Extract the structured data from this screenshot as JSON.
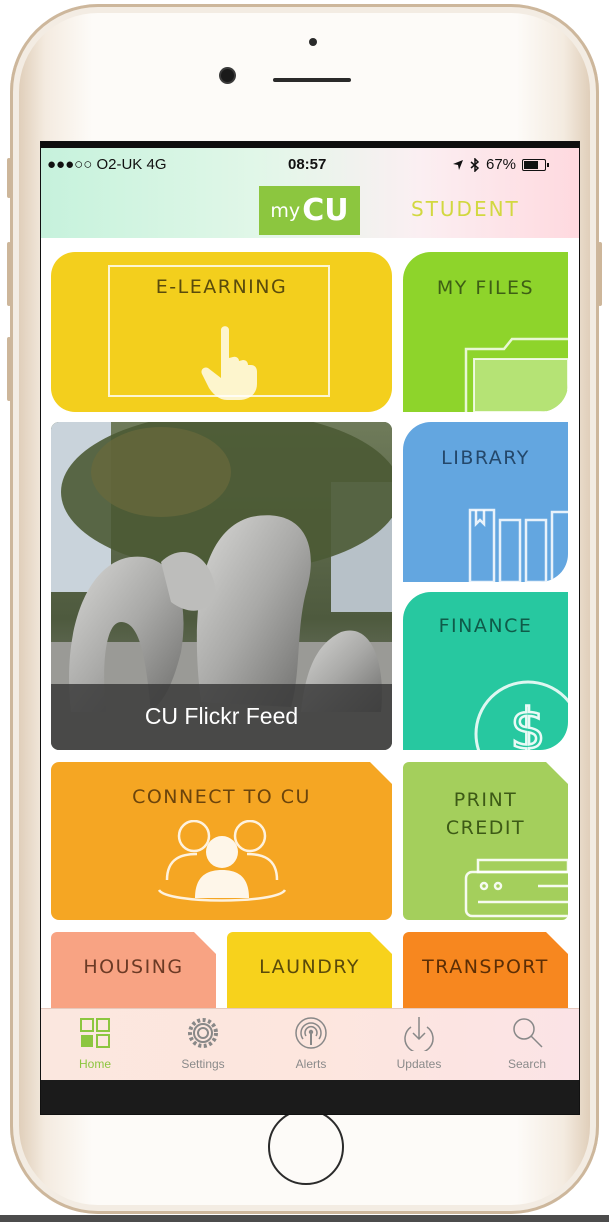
{
  "status_bar": {
    "carrier": "●●●○○ O2-UK  4G",
    "time": "08:57",
    "battery": "67%"
  },
  "header": {
    "logo_small": "my",
    "logo_big": "CU",
    "role": "STUDENT"
  },
  "tiles": {
    "elearning": "E-LEARNING",
    "my_files": "MY FILES",
    "library": "LIBRARY",
    "finance": "FINANCE",
    "flickr": "CU Flickr Feed",
    "connect": "CONNECT TO CU",
    "print_line1": "PRINT",
    "print_line2": "CREDIT",
    "housing": "HOUSING",
    "laundry": "LAUNDRY",
    "transport": "TRANSPORT"
  },
  "tabbar": {
    "home": "Home",
    "settings": "Settings",
    "alerts": "Alerts",
    "updates": "Updates",
    "search": "Search"
  },
  "colors": {
    "brand_green": "#8cc63f",
    "elearning": "#f3cf1d",
    "files": "#8ed42b",
    "library": "#63a6e0",
    "finance": "#27c8a0",
    "connect": "#f5a623",
    "print": "#a4cf5c",
    "housing": "#f8a383",
    "laundry": "#f7d21c",
    "transport": "#f7871f"
  },
  "icons": [
    "hand-pointer-icon",
    "folder-icon",
    "books-icon",
    "dollar-icon",
    "people-icon",
    "printer-icon",
    "grid-home-icon",
    "gear-icon",
    "broadcast-icon",
    "download-icon",
    "search-icon"
  ]
}
